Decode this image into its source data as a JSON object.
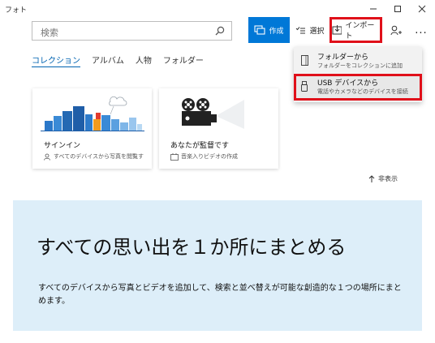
{
  "window": {
    "title": "フォト"
  },
  "search": {
    "placeholder": "検索"
  },
  "toolbar": {
    "create_label": "作成",
    "select_label": "選択",
    "import_label": "インポート",
    "more_label": "..."
  },
  "nav": {
    "tabs": [
      {
        "label": "コレクション",
        "active": true
      },
      {
        "label": "アルバム",
        "active": false
      },
      {
        "label": "人物",
        "active": false
      },
      {
        "label": "フォルダー",
        "active": false
      }
    ]
  },
  "cards": [
    {
      "title": "サインイン",
      "subtitle": "すべてのデバイスから写真を閲覧す"
    },
    {
      "title": "あなたが監督です",
      "subtitle": "音楽入りビデオの作成"
    }
  ],
  "hide_label": "非表示",
  "banner": {
    "title": "すべての思い出を１か所にまとめる",
    "body": "すべてのデバイスから写真とビデオを追加して、検索と並べ替えが可能な創造的な１つの場所にまとめます。"
  },
  "import_menu": {
    "items": [
      {
        "label": "フォルダーから",
        "description": "フォルダーをコレクションに追加"
      },
      {
        "label": "USB デバイスから",
        "description": "電話やカメラなどのデバイスを接続"
      }
    ]
  },
  "colors": {
    "accent": "#0078d7",
    "highlight_border": "#e0101a",
    "banner_bg": "#ddeef9"
  }
}
